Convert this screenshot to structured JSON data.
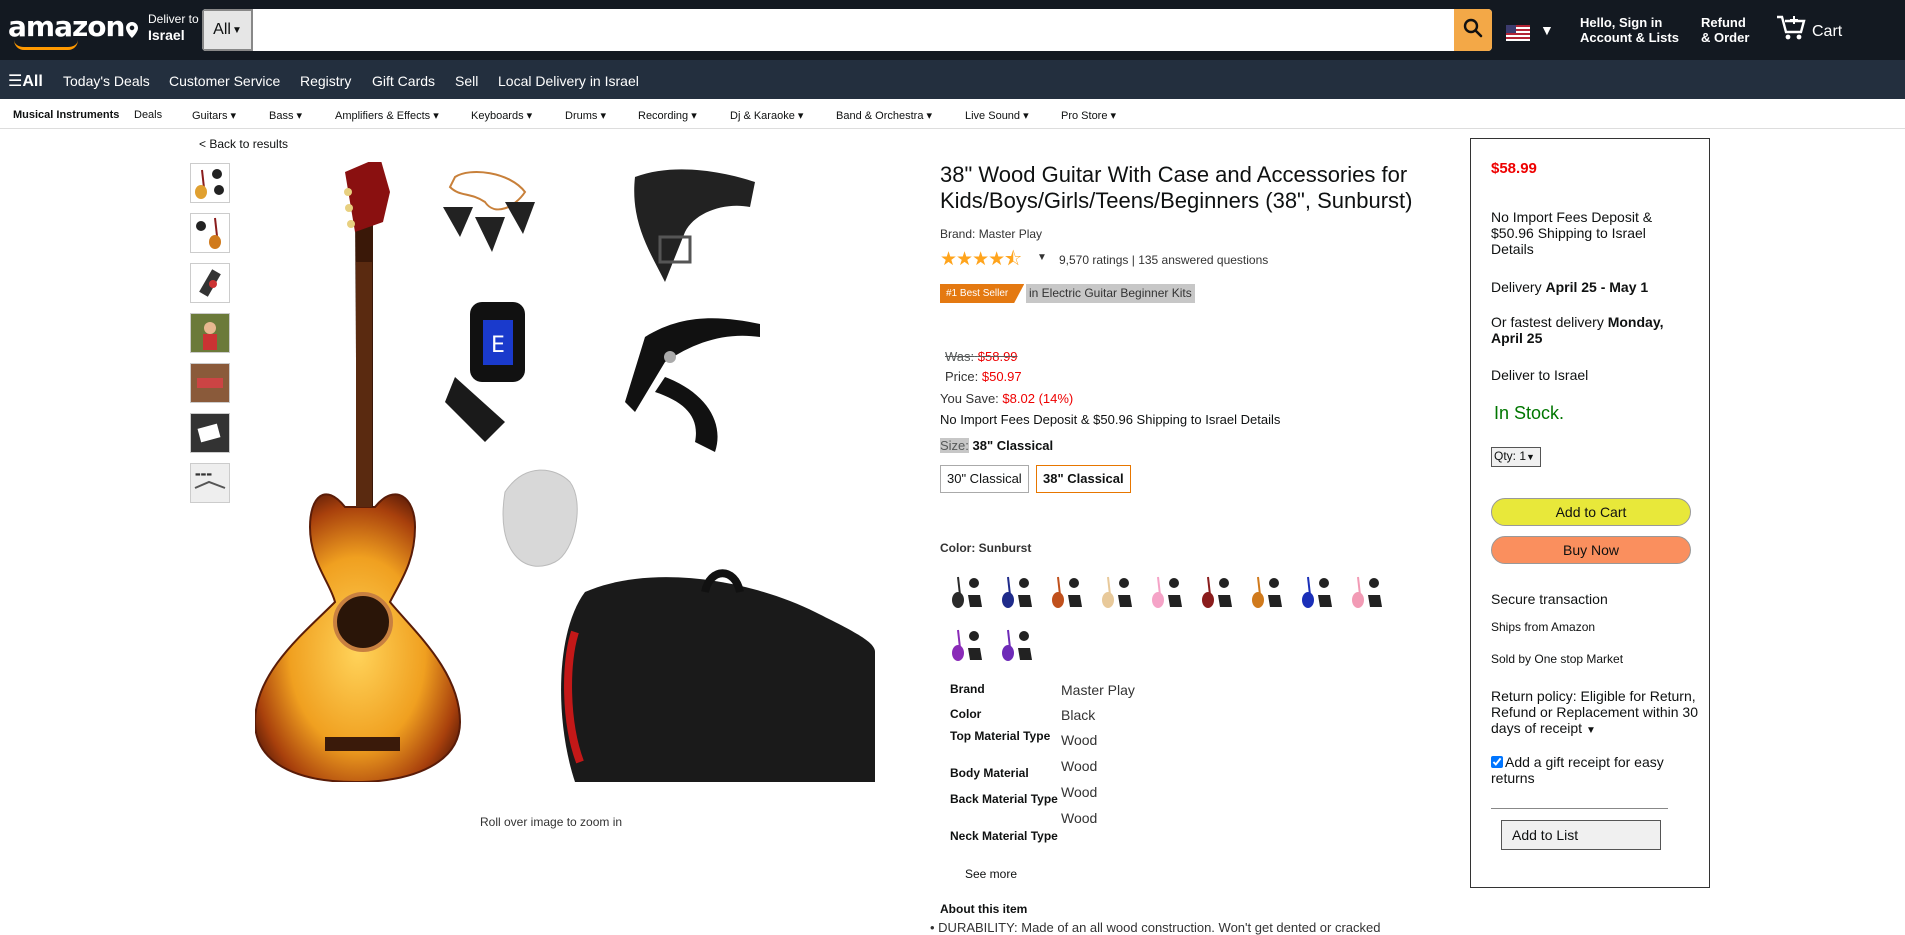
{
  "header": {
    "logo": "amazon",
    "deliver_line1": "Deliver to",
    "deliver_line2": "Israel",
    "search_category": "All",
    "search_placeholder": "",
    "account_line1": "Hello, Sign in",
    "account_line2": "Account & Lists",
    "refund_line1": "Refund",
    "refund_line2": "& Order",
    "cart": "Cart"
  },
  "nav": {
    "all": "All",
    "links": [
      "Today's Deals",
      "Customer Service",
      "Registry",
      "Gift Cards",
      "Sell",
      "Local Delivery in Israel"
    ]
  },
  "subnav": {
    "items": [
      "Musical Instruments",
      "Deals",
      "Guitars",
      "Bass",
      "Amplifiers & Effects",
      "Keyboards",
      "Drums",
      "Recording",
      "Dj & Karaoke",
      "Band & Orchestra",
      "Live Sound",
      "Pro Store"
    ]
  },
  "product": {
    "back": "< Back to results",
    "roll_over": "Roll over image to zoom in",
    "title": "38\" Wood Guitar With Case and Accessories for Kids/Boys/Girls/Teens/Beginners (38\", Sunburst)",
    "brand_line": "Brand: Master Play",
    "stars_display": "★★★★⯪",
    "ratings": "9,570 ratings",
    "answered": "135 answered questions",
    "best_seller": "#1 Best Seller",
    "best_category": "in Electric Guitar Beginner Kits",
    "was_label": "Was:",
    "was_value": "$58.99",
    "price_label": "Price:",
    "price_value": "$50.97",
    "save_label": "You Save:",
    "save_value": "$8.02 (14%)",
    "import_fees": "No Import Fees Deposit & $50.96 Shipping to Israel Details",
    "size_label": "Size:",
    "size_value": "38\" Classical",
    "size_options": [
      "30\" Classical",
      "38\" Classical"
    ],
    "color_label": "Color: Sunburst",
    "color_swatches": [
      "#2a2a2a",
      "#1f2b8a",
      "#c0501c",
      "#e8c99a",
      "#f5a3c7",
      "#8a1c1c",
      "#d07a1c",
      "#1a2fb8",
      "#f29bb5",
      "#8a2bb8",
      "#6e2bb8"
    ],
    "specs": [
      {
        "k": "Brand",
        "v": "Master Play"
      },
      {
        "k": "Color",
        "v": "Black"
      },
      {
        "k": "Top Material Type",
        "v": "Wood"
      },
      {
        "k": "Body Material",
        "v": "Wood"
      },
      {
        "k": "Back Material Type",
        "v": "Wood"
      },
      {
        "k": "Neck Material Type",
        "v": "Wood"
      }
    ],
    "see_more": "See more",
    "about": "About this item",
    "bullet1": "DURABILITY: Made of an all wood construction. Won't get dented or cracked"
  },
  "buybox": {
    "price": "$58.99",
    "import": "No Import Fees Deposit & $50.96 Shipping to Israel Details",
    "delivery_label": "Delivery",
    "delivery_dates": "April 25 - May 1",
    "fastest_label": "Or fastest delivery",
    "fastest_date": "Monday, April 25",
    "deliver_to": "Deliver to Israel",
    "stock": "In Stock.",
    "qty": "Qty: 1",
    "add_to_cart": "Add to Cart",
    "buy_now": "Buy Now",
    "secure": "Secure transaction",
    "ships_from": "Ships from Amazon",
    "sold_by": "Sold by One stop Market",
    "return_policy": "Return policy: Eligible for Return, Refund or Replacement within 30 days of receipt",
    "gift_receipt": "Add a gift receipt for easy returns",
    "add_to_list": "Add to List"
  },
  "colors": {
    "nav_dark": "#131921",
    "nav_mid": "#232f3e",
    "search_btn": "#f3a847",
    "price_red": "#e00000",
    "in_stock": "#007600",
    "best_seller": "#e47911"
  }
}
